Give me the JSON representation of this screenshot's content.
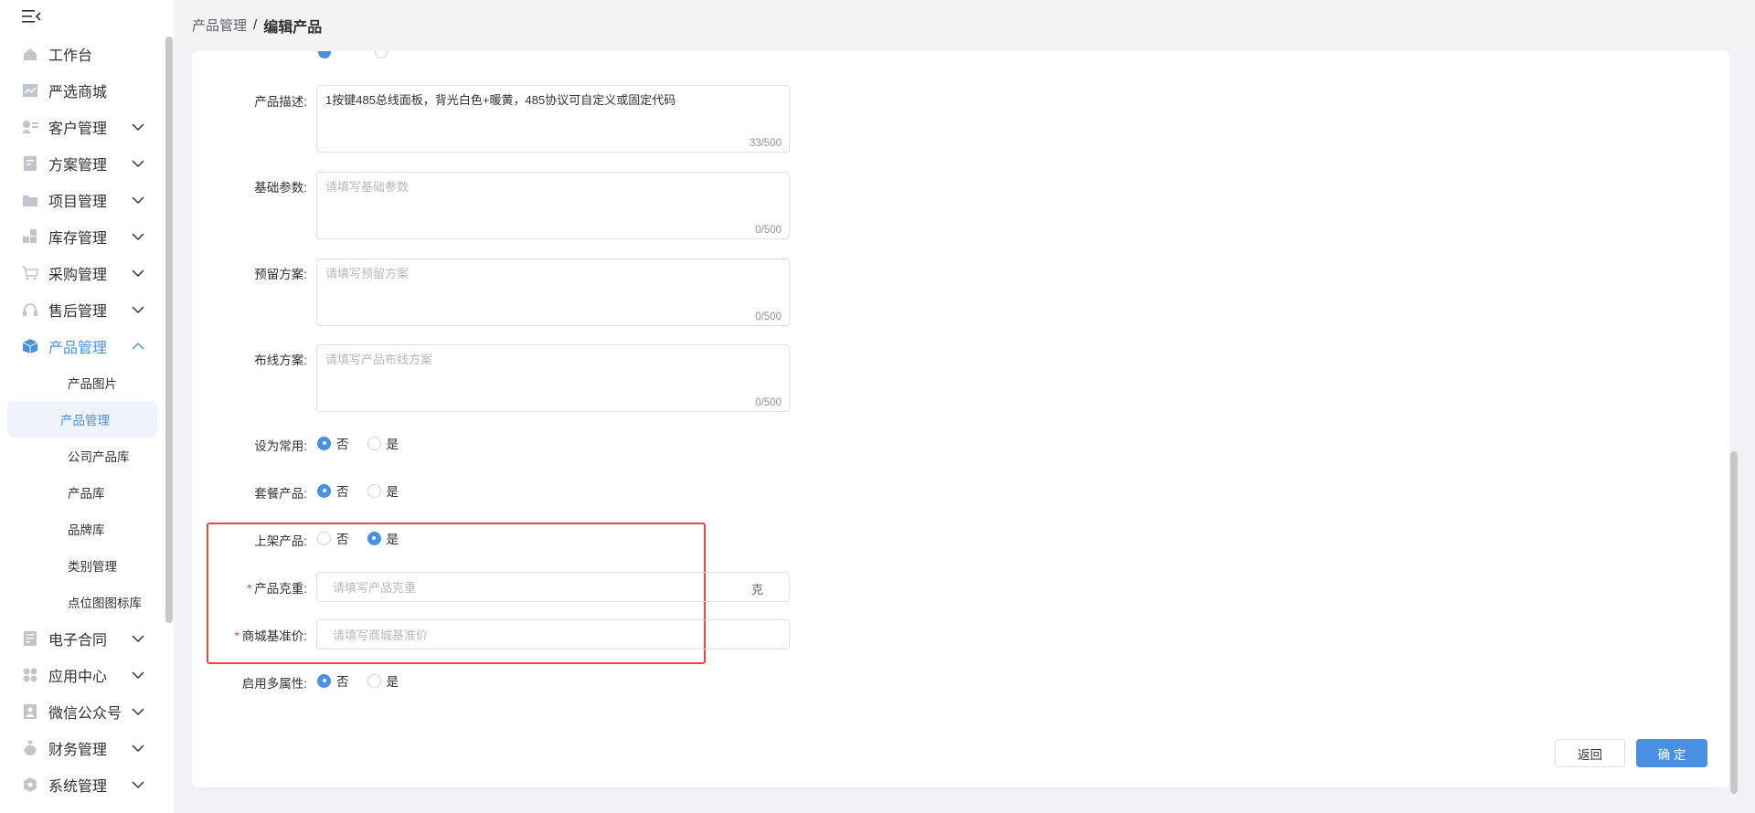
{
  "breadcrumb": {
    "parent": "产品管理",
    "separator": "/",
    "current": "编辑产品"
  },
  "sidebar": {
    "items": [
      {
        "label": "工作台",
        "icon": "home-icon",
        "expandable": false
      },
      {
        "label": "严选商城",
        "icon": "chart-icon",
        "expandable": false
      },
      {
        "label": "客户管理",
        "icon": "customer-icon",
        "expandable": true
      },
      {
        "label": "方案管理",
        "icon": "document-icon",
        "expandable": true
      },
      {
        "label": "项目管理",
        "icon": "folder-icon",
        "expandable": true
      },
      {
        "label": "库存管理",
        "icon": "inventory-icon",
        "expandable": true
      },
      {
        "label": "采购管理",
        "icon": "cart-icon",
        "expandable": true
      },
      {
        "label": "售后管理",
        "icon": "headset-icon",
        "expandable": true
      },
      {
        "label": "产品管理",
        "icon": "cube-icon",
        "expandable": true,
        "active": true
      }
    ],
    "sub_items": [
      {
        "label": "产品图片"
      },
      {
        "label": "产品管理",
        "active": true
      },
      {
        "label": "公司产品库"
      },
      {
        "label": "产品库"
      },
      {
        "label": "品牌库"
      },
      {
        "label": "类别管理"
      },
      {
        "label": "点位图图标库"
      }
    ],
    "items_after": [
      {
        "label": "电子合同",
        "icon": "contract-icon"
      },
      {
        "label": "应用中心",
        "icon": "apps-icon"
      },
      {
        "label": "微信公众号",
        "icon": "user-icon"
      },
      {
        "label": "财务管理",
        "icon": "finance-icon"
      },
      {
        "label": "系统管理",
        "icon": "settings-icon"
      }
    ]
  },
  "form": {
    "description": {
      "label": "产品描述:",
      "value": "1按键485总线面板，背光白色+暖黄，485协议可自定义或固定代码",
      "count": "33/500"
    },
    "basic_params": {
      "label": "基础参数:",
      "placeholder": "请填写基础参数",
      "count": "0/500"
    },
    "reserved_plan": {
      "label": "预留方案:",
      "placeholder": "请填写预留方案",
      "count": "0/500"
    },
    "wiring_plan": {
      "label": "布线方案:",
      "placeholder": "请填写产品布线方案",
      "count": "0/500"
    },
    "set_common": {
      "label": "设为常用:",
      "options": [
        "否",
        "是"
      ],
      "selected": "否"
    },
    "package_product": {
      "label": "套餐产品:",
      "options": [
        "否",
        "是"
      ],
      "selected": "否"
    },
    "listed_product": {
      "label": "上架产品:",
      "options": [
        "否",
        "是"
      ],
      "selected": "是"
    },
    "weight": {
      "label": "产品克重:",
      "required": "*",
      "placeholder": "请填写产品克重",
      "unit": "克"
    },
    "base_price": {
      "label": "商城基准价:",
      "required": "*",
      "placeholder": "请填写商城基准价"
    },
    "multi_attr": {
      "label": "启用多属性:",
      "options": [
        "否",
        "是"
      ],
      "selected": "否"
    }
  },
  "buttons": {
    "back": "返回",
    "confirm": "确 定"
  },
  "colors": {
    "primary": "#4a90e2",
    "highlight": "#e54b3c",
    "required": "#e74c3c"
  }
}
